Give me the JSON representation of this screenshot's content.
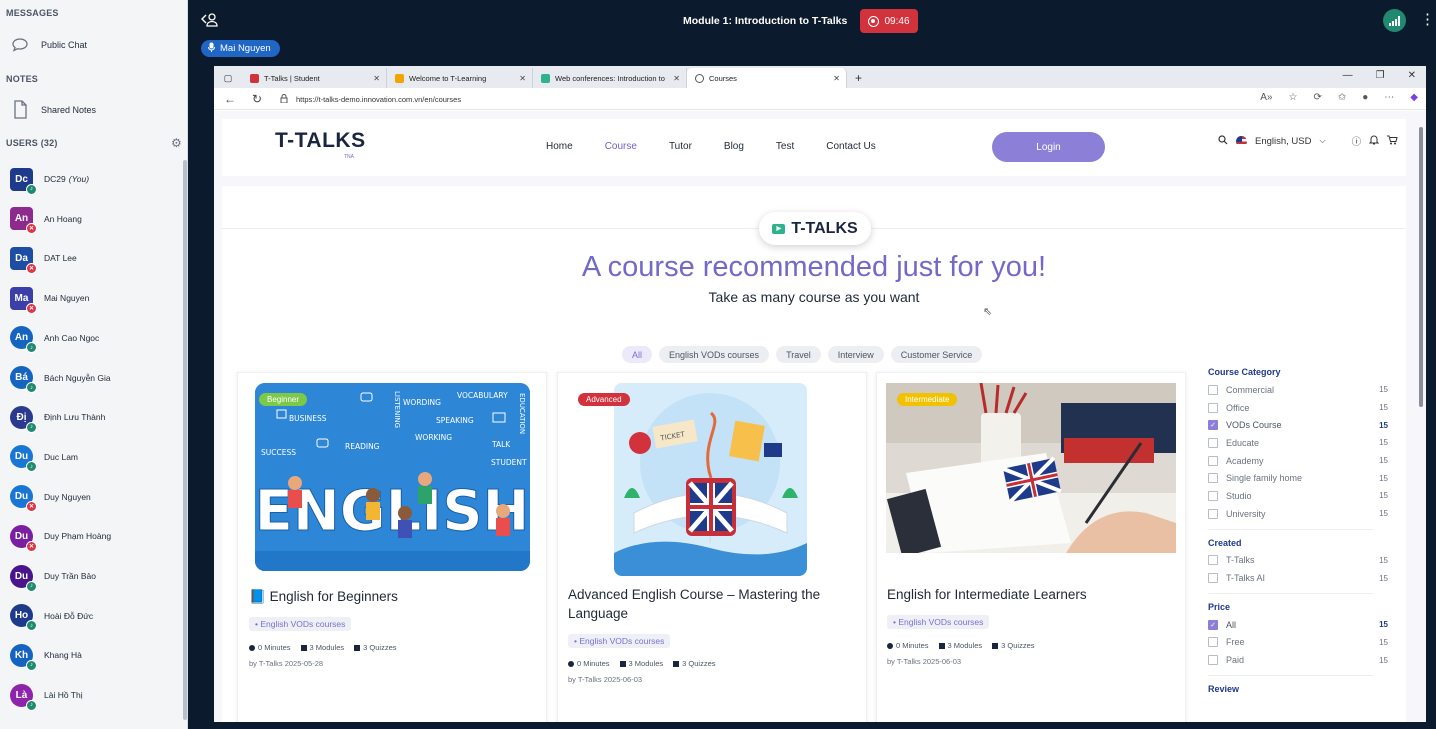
{
  "left_panel": {
    "messages_heading": "MESSAGES",
    "public_chat": "Public Chat",
    "notes_heading": "NOTES",
    "shared_notes": "Shared Notes",
    "users_heading": "USERS (32)",
    "users": [
      {
        "initials": "Dc",
        "name": "DC29",
        "suffix": "(You)",
        "color": "#1e3a8a",
        "status": "on",
        "circle": false
      },
      {
        "initials": "An",
        "name": "An Hoang",
        "suffix": "",
        "color": "#8e2a8e",
        "status": "off",
        "circle": false
      },
      {
        "initials": "Da",
        "name": "DAT Lee",
        "suffix": "",
        "color": "#1e4ea3",
        "status": "off",
        "circle": false
      },
      {
        "initials": "Ma",
        "name": "Mai Nguyen",
        "suffix": "",
        "color": "#3c3fa8",
        "status": "off",
        "circle": false
      },
      {
        "initials": "An",
        "name": "Anh Cao Ngoc",
        "suffix": "",
        "color": "#1565c0",
        "status": "on",
        "circle": true
      },
      {
        "initials": "Bá",
        "name": "Bách Nguyễn Gia",
        "suffix": "",
        "color": "#1565c0",
        "status": "on",
        "circle": true
      },
      {
        "initials": "Đị",
        "name": "Định Lưu Thành",
        "suffix": "",
        "color": "#2b3a8e",
        "status": "on",
        "circle": true
      },
      {
        "initials": "Du",
        "name": "Duc Lam",
        "suffix": "",
        "color": "#1976d2",
        "status": "on",
        "circle": true
      },
      {
        "initials": "Du",
        "name": "Duy Nguyen",
        "suffix": "",
        "color": "#1976d2",
        "status": "off",
        "circle": true
      },
      {
        "initials": "Du",
        "name": "Duy Phạm Hoàng",
        "suffix": "",
        "color": "#7b1fa2",
        "status": "off",
        "circle": true
      },
      {
        "initials": "Du",
        "name": "Duy Trần Bảo",
        "suffix": "",
        "color": "#4a148c",
        "status": "on",
        "circle": true
      },
      {
        "initials": "Ho",
        "name": "Hoài Đỗ Đức",
        "suffix": "",
        "color": "#1e3a8a",
        "status": "on",
        "circle": true
      },
      {
        "initials": "Kh",
        "name": "Khang Hà",
        "suffix": "",
        "color": "#1565c0",
        "status": "on",
        "circle": true
      },
      {
        "initials": "Là",
        "name": "Lài Hồ Thị",
        "suffix": "",
        "color": "#8e24aa",
        "status": "on",
        "circle": true
      }
    ]
  },
  "topbar": {
    "meeting_title": "Module 1: Introduction to T-Talks",
    "recording_time": "09:46",
    "presenter": "Mai Nguyen"
  },
  "browser": {
    "tabs": [
      {
        "label": "T-Talks | Student",
        "fav_color": "#d1323c",
        "active": false
      },
      {
        "label": "Welcome to T-Learning",
        "fav_color": "#f0a500",
        "active": false
      },
      {
        "label": "Web conferences: Introduction to",
        "fav_color": "#2fb38e",
        "active": false
      },
      {
        "label": "Courses",
        "fav_color": "#555555",
        "active": true
      }
    ],
    "url": "https://t-talks-demo.innovation.com.vn/en/courses"
  },
  "site": {
    "logo": "T-TALKS",
    "logo_sub": "TNA",
    "nav": [
      "Home",
      "Course",
      "Tutor",
      "Blog",
      "Test",
      "Contact Us"
    ],
    "login": "Login",
    "locale": "English, USD",
    "badge": "T-TALKS",
    "headline": "A course recommended just for you!",
    "subline": "Take as many course as you want",
    "filters": [
      "All",
      "English VODs courses",
      "Travel",
      "Interview",
      "Customer Service"
    ],
    "cards": [
      {
        "level": "Beginner",
        "level_color": "#7cc94a",
        "icon": "📘",
        "title": "English for Beginners",
        "tag": "English VODs courses",
        "minutes": "0 Minutes",
        "modules": "3 Modules",
        "quizzes": "3 Quizzes",
        "by": "by T-Talks  2025-05-28",
        "image_word": "ENGLISH"
      },
      {
        "level": "Advanced",
        "level_color": "#d1323c",
        "icon": "",
        "title": "Advanced English Course – Mastering the Language",
        "tag": "English VODs courses",
        "minutes": "0 Minutes",
        "modules": "3 Modules",
        "quizzes": "3 Quizzes",
        "by": "by T-Talks  2025-06-03",
        "image_word": "TICKET"
      },
      {
        "level": "Intermediate",
        "level_color": "#f2c200",
        "icon": "",
        "title": "English for Intermediate Learners",
        "tag": "English VODs courses",
        "minutes": "0 Minutes",
        "modules": "3 Modules",
        "quizzes": "3 Quizzes",
        "by": "by T-Talks  2025-06-03",
        "image_word": ""
      }
    ],
    "image_words": [
      "WORDING",
      "VOCABULARY",
      "BUSINESS",
      "SPEAKING",
      "READING",
      "WORKING",
      "SUCCESS",
      "TALK",
      "STUDENT",
      "LISTENING",
      "EDUCATION"
    ],
    "sidebar": {
      "category_heading": "Course Category",
      "categories": [
        {
          "label": "Commercial",
          "count": "15",
          "checked": false
        },
        {
          "label": "Office",
          "count": "15",
          "checked": false
        },
        {
          "label": "VODs Course",
          "count": "15",
          "checked": true
        },
        {
          "label": "Educate",
          "count": "15",
          "checked": false
        },
        {
          "label": "Academy",
          "count": "15",
          "checked": false
        },
        {
          "label": "Single family home",
          "count": "15",
          "checked": false
        },
        {
          "label": "Studio",
          "count": "15",
          "checked": false
        },
        {
          "label": "University",
          "count": "15",
          "checked": false
        }
      ],
      "created_heading": "Created",
      "created": [
        {
          "label": "T-Talks",
          "count": "15",
          "checked": false
        },
        {
          "label": "T-Talks AI",
          "count": "15",
          "checked": false
        }
      ],
      "price_heading": "Price",
      "price": [
        {
          "label": "All",
          "count": "15",
          "checked": true
        },
        {
          "label": "Free",
          "count": "15",
          "checked": false
        },
        {
          "label": "Paid",
          "count": "15",
          "checked": false
        }
      ],
      "review_heading": "Review"
    }
  }
}
